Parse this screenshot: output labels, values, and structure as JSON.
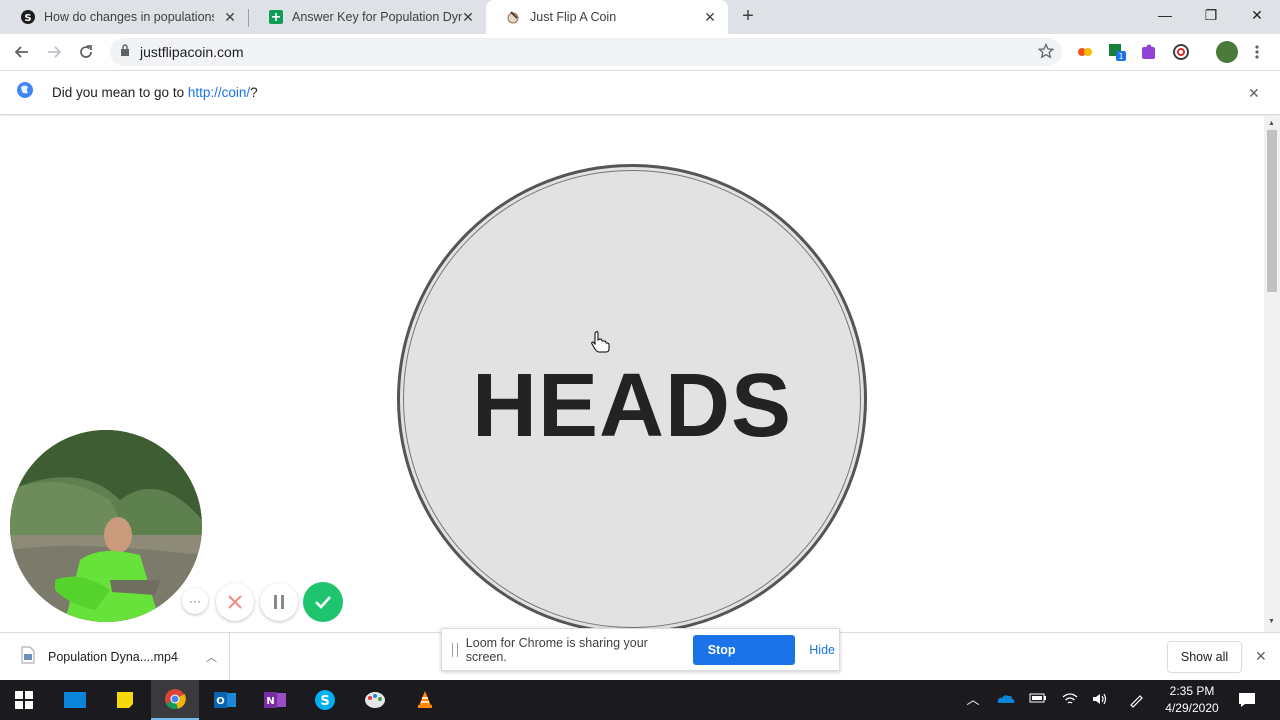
{
  "tabs": [
    {
      "title": "How do changes in populations a",
      "favicon": "skype-icon"
    },
    {
      "title": "Answer Key for Population Dynam",
      "favicon": "sheets-icon"
    },
    {
      "title": "Just Flip A Coin",
      "favicon": "coin-icon"
    }
  ],
  "address_bar": {
    "url": "justflipacoin.com"
  },
  "infobar": {
    "prefix": "Did you mean to go to ",
    "link": "http://coin/",
    "suffix": "?"
  },
  "coin": {
    "result": "HEADS"
  },
  "download": {
    "filename": "Population Dyna....mp4",
    "show_all": "Show all"
  },
  "loom": {
    "message": "Loom for Chrome is sharing your screen.",
    "stop_label": "Stop sharing",
    "hide_label": "Hide"
  },
  "clock": {
    "time": "2:35 PM",
    "date": "4/29/2020"
  },
  "colors": {
    "accent_blue": "#1a73e8",
    "loom_green": "#1ec46e",
    "coin_fill": "#e2e2e2"
  }
}
